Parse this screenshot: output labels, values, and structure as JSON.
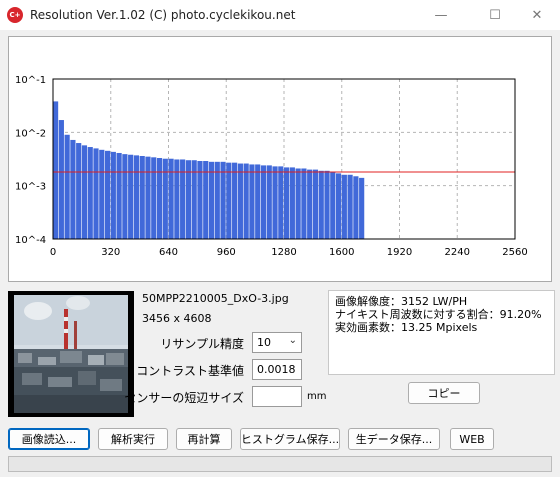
{
  "window": {
    "title": "Resolution Ver.1.02 (C) photo.cyclekikou.net",
    "icon_text": "C+",
    "minimize_symbol": "—",
    "maximize_symbol": "☐",
    "close_symbol": "✕"
  },
  "chart_data": {
    "type": "bar",
    "scale": "log",
    "xlim": [
      0,
      2560
    ],
    "ylim_exponents": [
      -4,
      -1
    ],
    "xticks": [
      "0",
      "320",
      "640",
      "960",
      "1280",
      "1600",
      "1920",
      "2240",
      "2560"
    ],
    "yticks": [
      "10^-1",
      "10^-2",
      "10^-3",
      "10^-4"
    ],
    "grid": true,
    "bar_color": "#4169d9",
    "threshold_line": {
      "value": 0.0018,
      "color": "#e02020"
    },
    "bin_width": 32,
    "values": [
      0.038,
      0.017,
      0.009,
      0.0072,
      0.0063,
      0.0057,
      0.0053,
      0.005,
      0.0047,
      0.0045,
      0.0043,
      0.0041,
      0.0039,
      0.0038,
      0.0037,
      0.0036,
      0.0035,
      0.0034,
      0.0033,
      0.0032,
      0.0032,
      0.0031,
      0.0031,
      0.003,
      0.003,
      0.0029,
      0.0029,
      0.0028,
      0.0028,
      0.0028,
      0.0027,
      0.0027,
      0.0026,
      0.0026,
      0.0025,
      0.0025,
      0.0024,
      0.0024,
      0.0023,
      0.0023,
      0.0022,
      0.0022,
      0.0021,
      0.0021,
      0.002,
      0.002,
      0.0019,
      0.0019,
      0.0018,
      0.0017,
      0.0016,
      0.0016,
      0.0015,
      0.0014
    ]
  },
  "image": {
    "file_name": "50MPP2210005_DxO-3.jpg",
    "dimensions": "3456 x 4608"
  },
  "settings": {
    "resample_label": "リサンプル精度",
    "resample_value": "10",
    "contrast_label": "コントラスト基準値",
    "contrast_value": "0.0018",
    "sensor_label": "センサーの短辺サイズ",
    "sensor_value": "",
    "sensor_unit": "mm"
  },
  "results": {
    "line1": "画像解像度：3152 LW/PH",
    "line2": "ナイキスト周波数に対する割合：91.20%",
    "line3": "実効画素数：13.25 Mpixels"
  },
  "buttons": {
    "copy": "コピー",
    "load_image": "画像読込...",
    "run_analysis": "解析実行",
    "recalc": "再計算",
    "save_histogram": "ヒストグラム保存...",
    "save_raw": "生データ保存...",
    "web": "WEB"
  },
  "progress": {
    "fraction": 0
  }
}
